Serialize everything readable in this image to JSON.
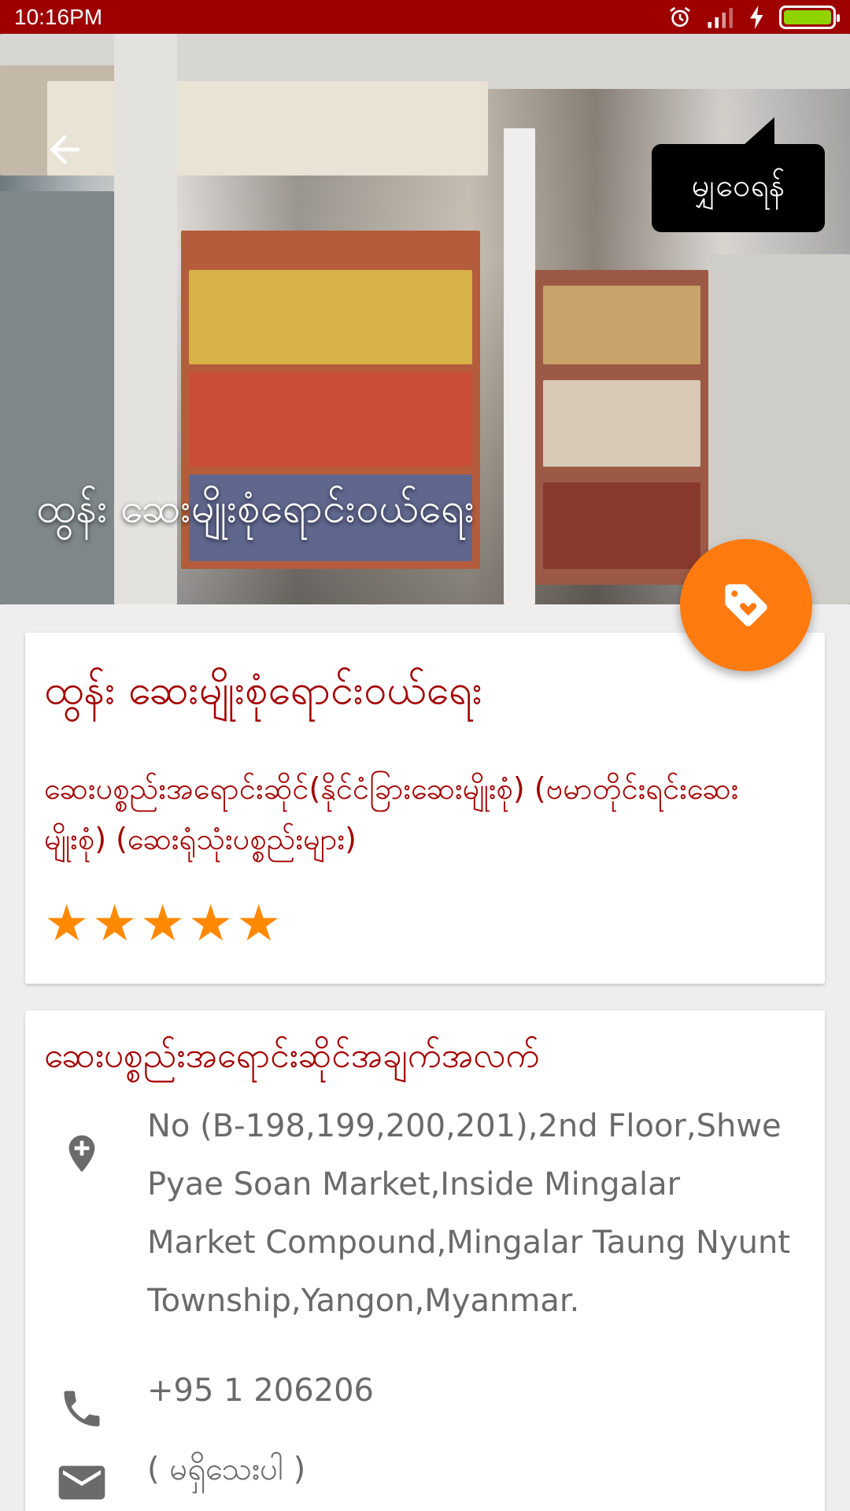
{
  "status_bar": {
    "time": "10:16PM"
  },
  "hero": {
    "title": "ထွန်း ဆေးမျိုးစုံရောင်းဝယ်ရေး",
    "tooltip": "မျှဝေရန်"
  },
  "shop": {
    "name": "ထွန်း ဆေးမျိုးစုံရောင်းဝယ်ရေး",
    "category": "ဆေးပစ္စည်းအရောင်းဆိုင်(နိုင်ငံခြားဆေးမျိုးစုံ) (ဗမာတိုင်းရင်းဆေးမျိုးစုံ) (ဆေးရုံသုံးပစ္စည်းများ)",
    "rating": 5,
    "stars": [
      "★",
      "★",
      "★",
      "★",
      "★"
    ]
  },
  "info": {
    "title": "ဆေးပစ္စည်းအရောင်းဆိုင်အချက်အလက်",
    "address": "No (B-198,199,200,201),2nd Floor,Shwe Pyae Soan Market,Inside Mingalar Market Compound,Mingalar Taung Nyunt Township,Yangon,Myanmar.",
    "phone": "+95 1 206206",
    "email": "( မရှိသေးပါ )"
  },
  "colors": {
    "status_bar": "#9e0000",
    "accent_text": "#a40000",
    "fab": "#ff7b10",
    "star": "#ff8a00"
  },
  "icons": [
    "back-arrow-icon",
    "tag-heart-icon",
    "add-location-icon",
    "phone-icon",
    "email-icon",
    "alarm-icon",
    "signal-icon",
    "charging-icon",
    "battery-icon"
  ]
}
